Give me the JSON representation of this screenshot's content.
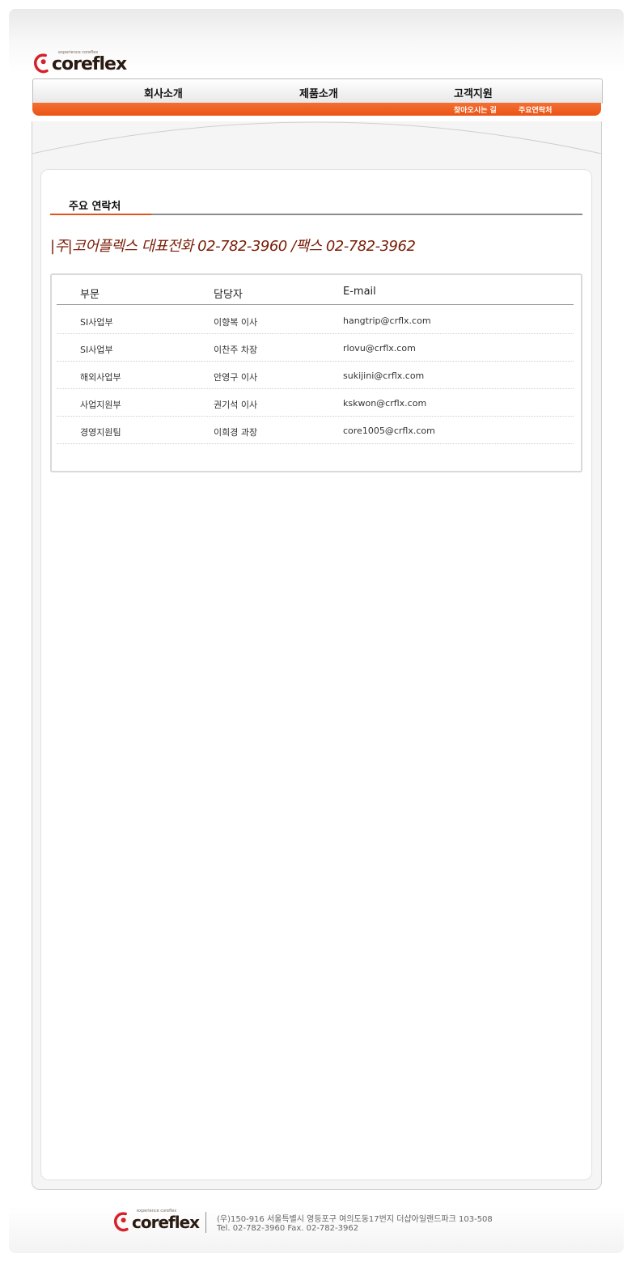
{
  "header": {
    "logo_text": "coreflex",
    "logo_tagline": "experience coreflex"
  },
  "nav": {
    "items": [
      "회사소개",
      "제품소개",
      "고객지원"
    ],
    "sub_items": [
      "찾아오시는 길",
      "주요연락처"
    ]
  },
  "content": {
    "section_title": "주요 연락처",
    "headline": "|주|코어플렉스 대표전화  02-782-3960 /팩스 02-782-3962",
    "table": {
      "headers": [
        "부문",
        "담당자",
        "E-mail"
      ],
      "rows": [
        [
          "SI사업부",
          "이향복 이사",
          "hangtrip@crflx.com"
        ],
        [
          "SI사업부",
          "이찬주 차장",
          "rlovu@crflx.com"
        ],
        [
          "해외사업부",
          "안영구 이사",
          "sukijini@crflx.com"
        ],
        [
          "사업지원부",
          "권기석 이사",
          "kskwon@crflx.com"
        ],
        [
          "경영지원팀",
          "이희경 과장",
          "core1005@crflx.com"
        ]
      ]
    }
  },
  "footer": {
    "logo_text": "coreflex",
    "logo_tagline": "experience coreflex",
    "address": "(우)150-916 서울특별시 영등포구 여의도동17번지 더샵아일랜드파크 103-508",
    "contact": "Tel. 02-782-3960    Fax. 02-782-3962"
  },
  "colors": {
    "accent_orange": "#EA5414",
    "headline_brown": "#7A1D07",
    "logo_red": "#D8202A"
  }
}
